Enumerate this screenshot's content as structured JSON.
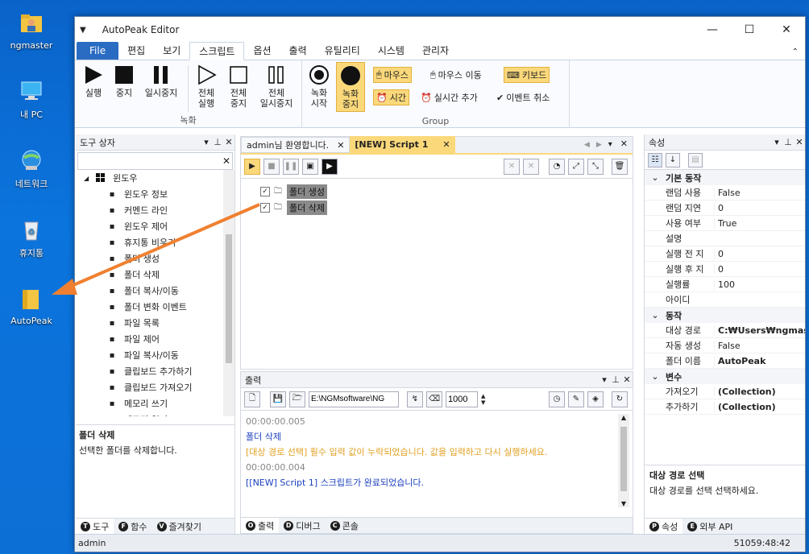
{
  "desktop": {
    "icons": [
      {
        "label": "ngmaster"
      },
      {
        "label": "내 PC"
      },
      {
        "label": "네트워크"
      },
      {
        "label": "휴지통"
      },
      {
        "label": "AutoPeak"
      }
    ]
  },
  "window": {
    "title": "AutoPeak Editor",
    "min": "—",
    "max": "☐",
    "close": "✕"
  },
  "menu": {
    "items": [
      "File",
      "편집",
      "보기",
      "스크립트",
      "옵션",
      "출력",
      "유틸리티",
      "시스템",
      "관리자"
    ],
    "active": "스크립트"
  },
  "ribbon": {
    "record": {
      "label": "녹화",
      "buttons": [
        {
          "label": "실행",
          "icon": "play-icon"
        },
        {
          "label": "중지",
          "icon": "stop-icon"
        },
        {
          "label": "일시중지",
          "icon": "pause-icon"
        },
        {
          "label1": "전체",
          "label2": "실행",
          "icon": "play-outline-icon"
        },
        {
          "label1": "전체",
          "label2": "중지",
          "icon": "stop-outline-icon"
        },
        {
          "label1": "전체",
          "label2": "일시중지",
          "icon": "pause-outline-icon"
        }
      ]
    },
    "group": {
      "label": "Group",
      "rec_start1": "녹화",
      "rec_start2": "시작",
      "rec_stop1": "녹화",
      "rec_stop2": "중지",
      "mouse": "마우스",
      "mouse_move": "마우스 이동",
      "keyboard": "키보드",
      "time": "시간",
      "realtime_add": "실시간 추가",
      "event_cancel": "이벤트 취소"
    }
  },
  "toolbox": {
    "title": "도구 상자",
    "root": "윈도우",
    "items": [
      {
        "label": "윈도우 정보",
        "icon": "search-icon"
      },
      {
        "label": "커멘드 라인",
        "icon": "console-icon"
      },
      {
        "label": "윈도우 제어",
        "icon": "windows-icon"
      },
      {
        "label": "휴지통 비우기",
        "icon": "trash-icon"
      },
      {
        "label": "폴더 생성",
        "icon": "folder-add-icon"
      },
      {
        "label": "폴더 삭제",
        "icon": "folder-delete-icon"
      },
      {
        "label": "폴더 복사/이동",
        "icon": "folder-copy-icon"
      },
      {
        "label": "폴더 변화 이벤트",
        "icon": "lightning-icon"
      },
      {
        "label": "파일 목록",
        "icon": "list-icon"
      },
      {
        "label": "파일 제어",
        "icon": "file-icon"
      },
      {
        "label": "파일 복사/이동",
        "icon": "file-copy-icon"
      },
      {
        "label": "클립보드 추가하기",
        "icon": "clipboard-icon"
      },
      {
        "label": "클립보드 가져오기",
        "icon": "clipboard-icon"
      },
      {
        "label": "메모리 쓰기",
        "icon": "memory-icon"
      },
      {
        "label": "메모리 읽기",
        "icon": "memory-icon"
      }
    ],
    "desc_title": "폴더 삭제",
    "desc_text": "선택한 폴더를 삭제합니다.",
    "tabs": [
      {
        "label": "도구",
        "letter": "T"
      },
      {
        "label": "함수",
        "letter": "F"
      },
      {
        "label": "즐겨찾기",
        "letter": "V"
      }
    ]
  },
  "editor": {
    "tabs": [
      {
        "label": "admin님 환영합니다."
      },
      {
        "label": "[NEW] Script 1"
      }
    ],
    "nodes": [
      {
        "label": "폴더 생성"
      },
      {
        "label": "폴더 삭제"
      }
    ]
  },
  "output": {
    "title": "출력",
    "path": "E:\\NGMsoftware\\NG",
    "count": "1000",
    "lines": [
      {
        "text": "00:00:00.005",
        "color": "#888888"
      },
      {
        "text": "폴더 삭제",
        "color": "#1b3fbf"
      },
      {
        "text": "[대상 경로 선택] 필수 입력 값이 누락되었습니다. 값을 입력하고 다시 실행하세요.",
        "color": "#e0a020"
      },
      {
        "text": "00:00:00.004",
        "color": "#888888"
      },
      {
        "text": "[[NEW] Script 1] 스크립트가 완료되었습니다.",
        "color": "#1b3fbf"
      }
    ],
    "tabs": [
      {
        "label": "출력",
        "letter": "O"
      },
      {
        "label": "디버그",
        "letter": "D"
      },
      {
        "label": "콘솔",
        "letter": "C"
      }
    ]
  },
  "properties": {
    "title": "속성",
    "categories": [
      {
        "name": "기본 동작",
        "rows": [
          {
            "name": "랜덤 사용",
            "value": "False"
          },
          {
            "name": "랜덤 지연",
            "value": "0"
          },
          {
            "name": "사용 여부",
            "value": "True"
          },
          {
            "name": "설명",
            "value": ""
          },
          {
            "name": "실행 전 지",
            "value": "0"
          },
          {
            "name": "실행 후 지",
            "value": "0"
          },
          {
            "name": "실행률",
            "value": "100"
          },
          {
            "name": "아이디",
            "value": ""
          }
        ]
      },
      {
        "name": "동작",
        "rows": [
          {
            "name": "대상 경로",
            "value": "C:₩Users₩ngmaste",
            "bold": true
          },
          {
            "name": "자동 생성",
            "value": "False"
          },
          {
            "name": "폴더 이름",
            "value": "AutoPeak",
            "bold": true
          }
        ]
      },
      {
        "name": "변수",
        "rows": [
          {
            "name": "가져오기",
            "value": "(Collection)",
            "bold": true
          },
          {
            "name": "추가하기",
            "value": "(Collection)",
            "bold": true
          }
        ]
      }
    ],
    "desc_title": "대상 경로 선택",
    "desc_text": "대상 경로를 선택 선택하세요.",
    "tabs": [
      {
        "label": "속성",
        "letter": "P"
      },
      {
        "label": "외부 API",
        "letter": "E"
      }
    ]
  },
  "status": {
    "user": "admin",
    "time": "51059:48:42"
  },
  "colors": {
    "accent": "#2b6cc3",
    "arrow": "#f08030",
    "highlight": "#fbd97b"
  }
}
